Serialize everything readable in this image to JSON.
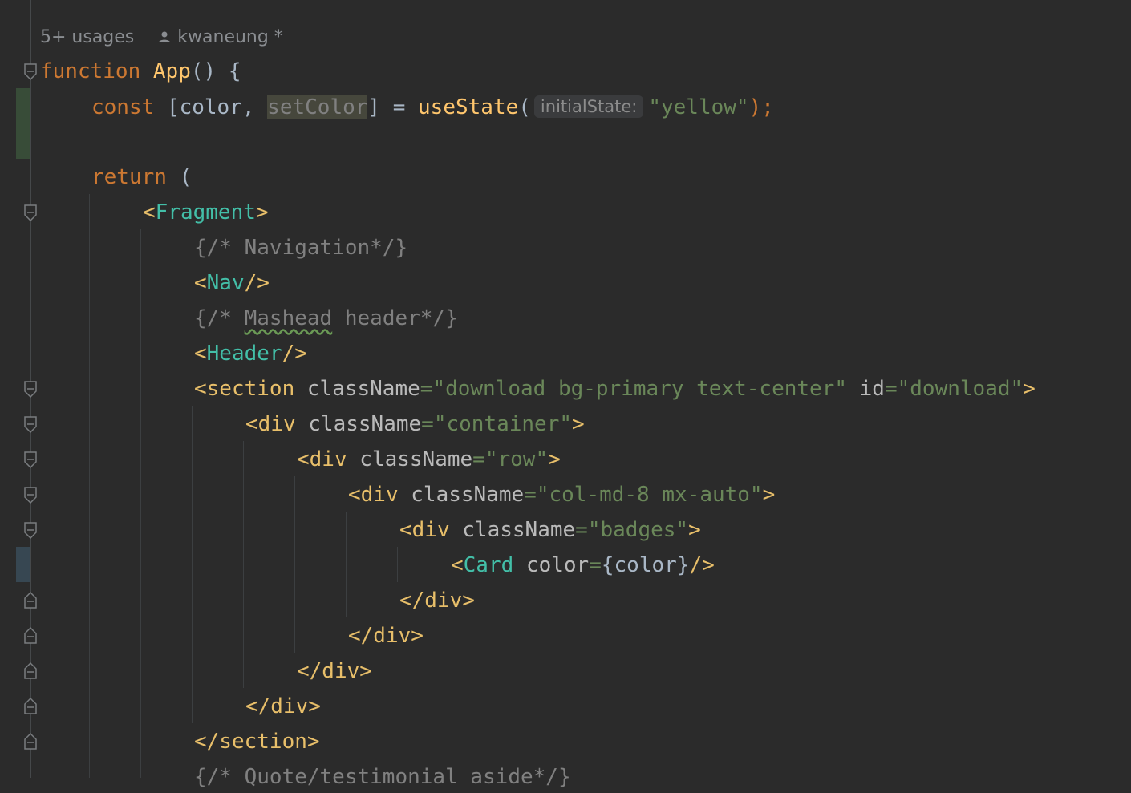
{
  "inlay": {
    "usages": "5+ usages",
    "author": "kwaneung *",
    "param_hint": "initialState:"
  },
  "code": {
    "l1_kw": "function",
    "l1_name": "App",
    "l1_rest": "() {",
    "l2_kw": "const",
    "l2_a": "[color,",
    "l2_setter": "setColor",
    "l2_b": "] =",
    "l2_call": "useState",
    "l2_paren": "(",
    "l2_str": "\"yellow\"",
    "l2_end": ");",
    "l4_kw": "return",
    "l4_rest": " (",
    "fragment_open_lt": "<",
    "fragment_name": "Fragment",
    "fragment_open_gt": ">",
    "comment_nav": "{/* Navigation*/}",
    "nav_lt": "<",
    "nav_name": "Nav",
    "nav_end": "/>",
    "comment_mashead_a": "{/* ",
    "comment_mashead_word": "Mashead",
    "comment_mashead_b": " header*/}",
    "header_lt": "<",
    "header_name": "Header",
    "header_end": "/>",
    "section_open": "<section",
    "section_attr1": "className",
    "section_eq1": "=",
    "section_val1": "\"download bg-primary text-center\"",
    "section_attr2": "id",
    "section_eq2": "=",
    "section_val2": "\"download\"",
    "section_gt": ">",
    "div_open": "<div",
    "div_attr": "className",
    "div_eq": "=",
    "div_val_container": "\"container\"",
    "div_val_row": "\"row\"",
    "div_val_col": "\"col-md-8 mx-auto\"",
    "div_val_badges": "\"badges\"",
    "div_gt": ">",
    "card_lt": "<",
    "card_name": "Card",
    "card_attr": "color",
    "card_eq": "=",
    "card_val": "{color}",
    "card_end": "/>",
    "div_close": "</div>",
    "section_close": "</section>",
    "comment_quote": "{/* Quote/testimonial aside*/}"
  },
  "colors": {
    "background": "#2b2b2b",
    "keyword": "#cc7832",
    "function": "#ffc66d",
    "tag": "#e8bf6a",
    "component": "#43bfa8",
    "string": "#6a8759",
    "comment": "#808080",
    "changed_line_marker": "#384c38",
    "modified_line_marker": "#374752"
  },
  "icons": {
    "author": "person-icon",
    "fold": "fold-marker-icon"
  }
}
